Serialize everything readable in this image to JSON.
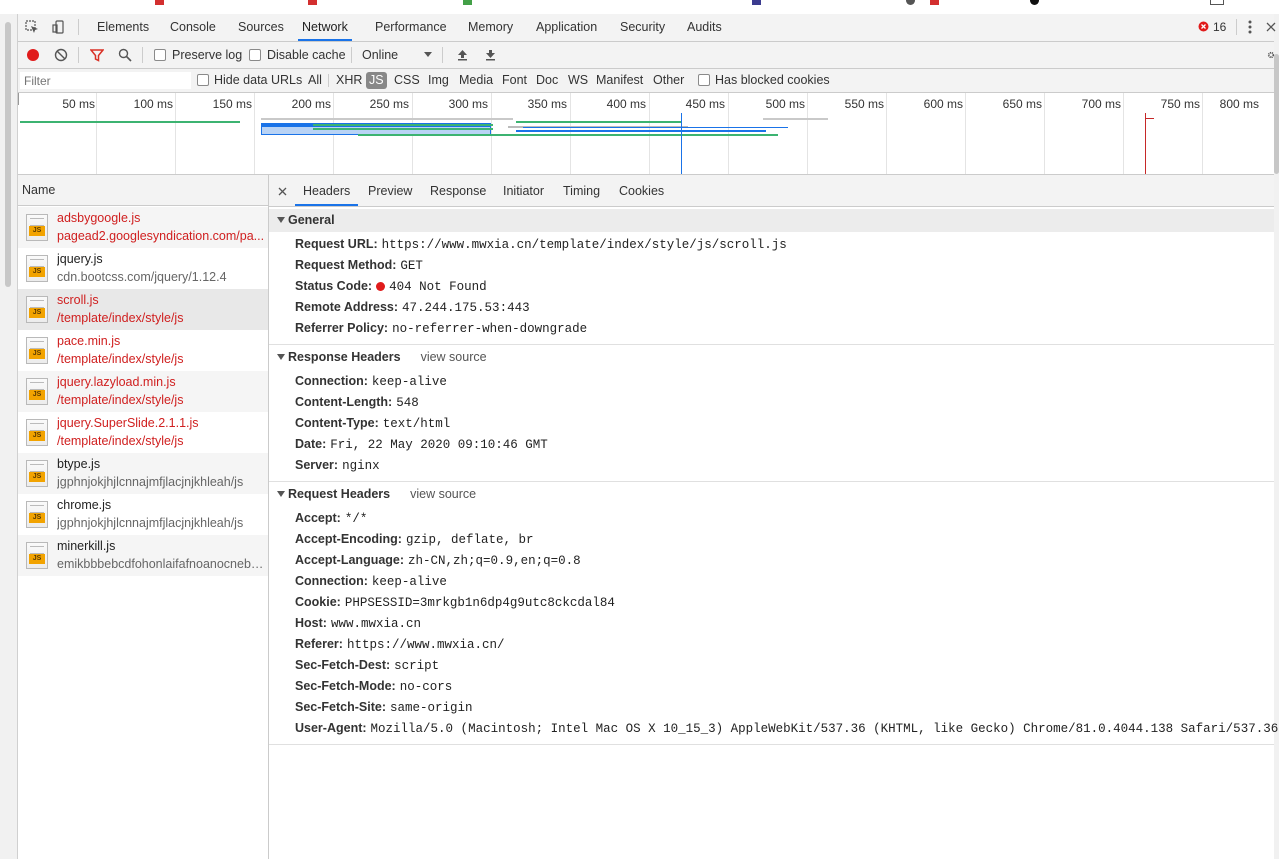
{
  "tabs": [
    "Elements",
    "Console",
    "Sources",
    "Network",
    "Performance",
    "Memory",
    "Application",
    "Security",
    "Audits"
  ],
  "error_count": "16",
  "toolbar": {
    "preserve_log": "Preserve log",
    "disable_cache": "Disable cache",
    "throttle": "Online"
  },
  "filterbar": {
    "placeholder": "Filter",
    "hide_data_urls": "Hide data URLs",
    "types": [
      "All",
      "XHR",
      "JS",
      "CSS",
      "Img",
      "Media",
      "Font",
      "Doc",
      "WS",
      "Manifest",
      "Other"
    ],
    "selected_type": "JS",
    "blocked_cookies": "Has blocked cookies"
  },
  "overview": {
    "ticks": [
      "50 ms",
      "100 ms",
      "150 ms",
      "200 ms",
      "250 ms",
      "300 ms",
      "350 ms",
      "400 ms",
      "450 ms",
      "500 ms",
      "550 ms",
      "600 ms",
      "650 ms",
      "700 ms",
      "750 ms",
      "800 ms"
    ]
  },
  "list": {
    "header": "Name",
    "rows": [
      {
        "name": "adsbygoogle.js",
        "path": "pagead2.googlesyndication.com/pa...",
        "status": "error"
      },
      {
        "name": "jquery.js",
        "path": "cdn.bootcss.com/jquery/1.12.4",
        "status": "ok"
      },
      {
        "name": "scroll.js",
        "path": "/template/index/style/js",
        "status": "error"
      },
      {
        "name": "pace.min.js",
        "path": "/template/index/style/js",
        "status": "error"
      },
      {
        "name": "jquery.lazyload.min.js",
        "path": "/template/index/style/js",
        "status": "error"
      },
      {
        "name": "jquery.SuperSlide.2.1.1.js",
        "path": "/template/index/style/js",
        "status": "error"
      },
      {
        "name": "btype.js",
        "path": "jgphnjokjhjlcnnajmfjlacjnjkhleah/js",
        "status": "ok"
      },
      {
        "name": "chrome.js",
        "path": "jgphnjokjhjlcnnajmfjlacjnjkhleah/js",
        "status": "ok"
      },
      {
        "name": "minerkill.js",
        "path": "emikbbbebcdfohonlaifafnoanocnebl/js",
        "status": "ok"
      }
    ]
  },
  "detail_tabs": [
    "Headers",
    "Preview",
    "Response",
    "Initiator",
    "Timing",
    "Cookies"
  ],
  "general": {
    "title": "General",
    "items": [
      {
        "k": "Request URL:",
        "v": "https://www.mwxia.cn/template/index/style/js/scroll.js"
      },
      {
        "k": "Request Method:",
        "v": "GET"
      },
      {
        "k": "Status Code:",
        "v": "404 Not Found"
      },
      {
        "k": "Remote Address:",
        "v": "47.244.175.53:443"
      },
      {
        "k": "Referrer Policy:",
        "v": "no-referrer-when-downgrade"
      }
    ]
  },
  "response_headers": {
    "title": "Response Headers",
    "view_source": "view source",
    "items": [
      {
        "k": "Connection:",
        "v": "keep-alive"
      },
      {
        "k": "Content-Length:",
        "v": "548"
      },
      {
        "k": "Content-Type:",
        "v": "text/html"
      },
      {
        "k": "Date:",
        "v": "Fri, 22 May 2020 09:10:46 GMT"
      },
      {
        "k": "Server:",
        "v": "nginx"
      }
    ]
  },
  "request_headers": {
    "title": "Request Headers",
    "view_source": "view source",
    "items": [
      {
        "k": "Accept:",
        "v": "*/*"
      },
      {
        "k": "Accept-Encoding:",
        "v": "gzip, deflate, br"
      },
      {
        "k": "Accept-Language:",
        "v": "zh-CN,zh;q=0.9,en;q=0.8"
      },
      {
        "k": "Connection:",
        "v": "keep-alive"
      },
      {
        "k": "Cookie:",
        "v": "PHPSESSID=3mrkgb1n6dp4g9utc8ckcdal84"
      },
      {
        "k": "Host:",
        "v": "www.mwxia.cn"
      },
      {
        "k": "Referer:",
        "v": "https://www.mwxia.cn/"
      },
      {
        "k": "Sec-Fetch-Dest:",
        "v": "script"
      },
      {
        "k": "Sec-Fetch-Mode:",
        "v": "no-cors"
      },
      {
        "k": "Sec-Fetch-Site:",
        "v": "same-origin"
      },
      {
        "k": "User-Agent:",
        "v": "Mozilla/5.0 (Macintosh; Intel Mac OS X 10_15_3) AppleWebKit/537.36 (KHTML, like Gecko) Chrome/81.0.4044.138 Safari/537.36"
      }
    ]
  },
  "colors": {
    "accent": "#1a73e8",
    "error": "#d02020",
    "record": "#e01b1b"
  }
}
